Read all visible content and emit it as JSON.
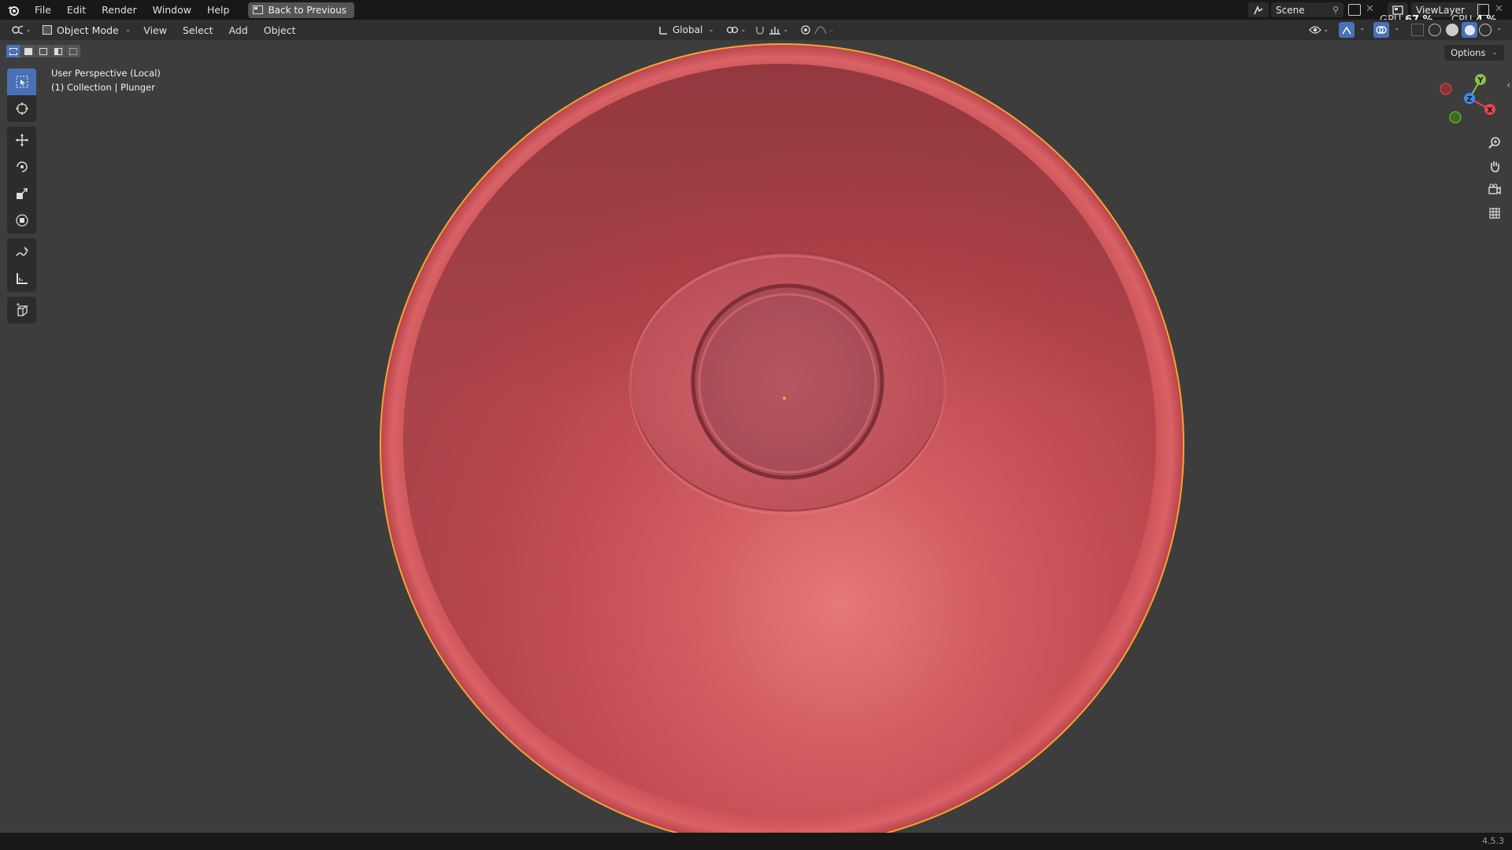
{
  "menu": {
    "items": [
      "File",
      "Edit",
      "Render",
      "Window",
      "Help"
    ],
    "back_button": "Back to Previous"
  },
  "topright": {
    "scene_label": "Scene",
    "view_layer_label": "ViewLayer",
    "gpu_label": "GPU",
    "gpu_value": "67 %",
    "cpu_label": "CPU",
    "cpu_value": "4 %"
  },
  "header": {
    "mode": "Object Mode",
    "menus": [
      "View",
      "Select",
      "Add",
      "Object"
    ],
    "orientation": "Global",
    "options": "Options"
  },
  "viewport": {
    "view_name": "User Perspective (Local)",
    "collection_info": "(1) Collection | Plunger",
    "object_color": "#c9454d",
    "selection_outline_color": "#f5a432",
    "background_color": "#3d3d3d"
  },
  "gizmo": {
    "x_label": "X",
    "y_label": "Y",
    "z_label": "Z"
  },
  "statusbar": {
    "version": "4.5.3"
  }
}
